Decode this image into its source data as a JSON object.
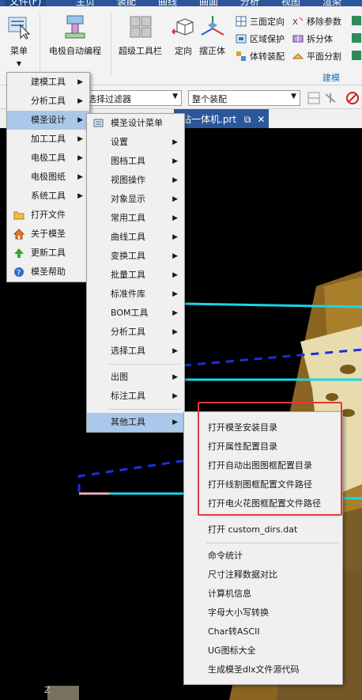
{
  "menubar": {
    "items": [
      "文件(F)",
      "主页",
      "装配",
      "曲线",
      "曲面",
      "分析",
      "视图",
      "渲染"
    ]
  },
  "ribbon": {
    "menu_button": "菜单",
    "electrode": "电极自动编程",
    "super_toolbar": "超级工具栏",
    "locate": "定向",
    "place_upright": "摆正体",
    "three_face_orient": "三面定向",
    "region_protect": "区域保护",
    "body_assembly": "体转装配",
    "remove_params": "移除参数",
    "split_body": "拆分体",
    "plane_split": "平面分割",
    "group_label": "建模"
  },
  "filterbar": {
    "selection_filter": "选择过滤器",
    "assembly_scope": "整个装配"
  },
  "file_tab": {
    "label": "钻一体机.prt"
  },
  "main_menu": {
    "items": [
      {
        "label": "建模工具",
        "submenu": true
      },
      {
        "label": "分析工具",
        "submenu": true
      },
      {
        "label": "模圣设计",
        "submenu": true,
        "highlighted": true
      },
      {
        "label": "加工工具",
        "submenu": true
      },
      {
        "label": "电极工具",
        "submenu": true
      },
      {
        "label": "电极图纸",
        "submenu": true
      },
      {
        "label": "系统工具",
        "submenu": true
      },
      {
        "label": "打开文件",
        "icon": "folder-icon"
      },
      {
        "label": "关于模圣",
        "icon": "home-icon"
      },
      {
        "label": "更新工具",
        "icon": "update-arrow-icon"
      },
      {
        "label": "模圣帮助",
        "icon": "help-icon"
      }
    ]
  },
  "design_menu": {
    "items": [
      {
        "label": "模圣设计菜单",
        "icon": "menu-icon"
      },
      {
        "label": "设置",
        "submenu": true
      },
      {
        "label": "图档工具",
        "submenu": true
      },
      {
        "label": "视图操作",
        "submenu": true
      },
      {
        "label": "对象显示",
        "submenu": true
      },
      {
        "label": "常用工具",
        "submenu": true
      },
      {
        "label": "曲线工具",
        "submenu": true
      },
      {
        "label": "变换工具",
        "submenu": true
      },
      {
        "label": "批量工具",
        "submenu": true
      },
      {
        "label": "标准件库",
        "submenu": true
      },
      {
        "label": "BOM工具",
        "submenu": true
      },
      {
        "label": "分析工具",
        "submenu": true
      },
      {
        "label": "选择工具",
        "submenu": true
      }
    ],
    "group2": [
      {
        "label": "出图",
        "submenu": true
      },
      {
        "label": "标注工具",
        "submenu": true
      }
    ],
    "group3": [
      {
        "label": "其他工具",
        "submenu": true,
        "highlighted": true
      }
    ]
  },
  "other_tools_menu": {
    "items": [
      "打开模圣安装目录",
      "打开属性配置目录",
      "打开自动出图图框配置目录",
      "打开线割图框配置文件路径",
      "打开电火花图框配置文件路径"
    ],
    "custom_dirs": "打开 custom_dirs.dat",
    "items2": [
      "命令统计",
      "尺寸注释数据对比",
      "计算机信息",
      "字母大小写转换",
      "Char转ASCII",
      "UG图标大全",
      "生成模圣dlx文件源代码"
    ]
  },
  "colors": {
    "menubar": "#2b579a",
    "menu_bg": "#f0f0f0",
    "highlight": "#a9c8ea",
    "annotation_box": "#e03a3a",
    "cyan_line": "#19d6e6",
    "blue_dash": "#1d2fe0",
    "model_gold": "#8a6420",
    "model_cream": "#e8dcae"
  },
  "axis_label": "Z"
}
